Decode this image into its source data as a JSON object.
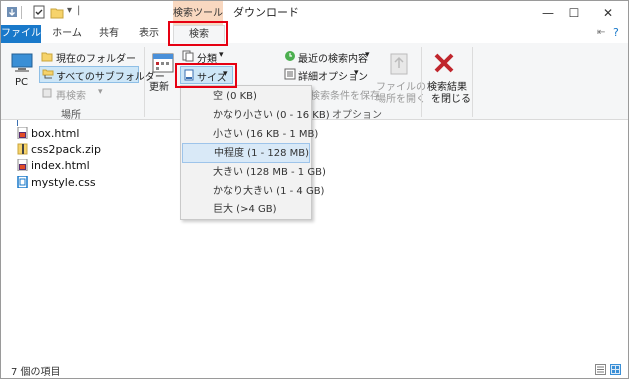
{
  "titlebar": {
    "context_tool": "検索ツール",
    "title": "ダウンロード",
    "minimize": "—",
    "maximize": "☐",
    "close": "✕"
  },
  "tabs": {
    "file": "ファイル",
    "home": "ホーム",
    "share": "共有",
    "view": "表示",
    "search": "検索"
  },
  "ribbon": {
    "location": {
      "pc": "PC",
      "current_folder": "現在のフォルダー",
      "all_subfolders": "すべてのサブフォルダー",
      "search_again": "再検索",
      "group_label": "場所"
    },
    "refine": {
      "refresh": "更新",
      "kind": "分類",
      "size": "サイズ"
    },
    "options": {
      "recent_searches": "最近の検索内容",
      "advanced_options": "詳細オプション",
      "save_search": "検索条件を保存",
      "open_location_line1": "ファイルの",
      "open_location_line2": "場所を開く",
      "close_search_line1": "検索結果",
      "close_search_line2": "を閉じる",
      "group_label": "オプション"
    }
  },
  "size_menu": {
    "items": [
      "空 (0 KB)",
      "かなり小さい (0 - 16 KB)",
      "小さい (16 KB - 1 MB)",
      "中程度 (1 - 128 MB)",
      "大きい (128 MB - 1 GB)",
      "かなり大きい (1 - 4 GB)",
      "巨大 (>4 GB)"
    ],
    "selected": "中程度 (1 - 128 MB)"
  },
  "files": [
    "box.html",
    "css2pack.zip",
    "index.html",
    "mystyle.css"
  ],
  "status": {
    "item_count": "7 個の項目"
  },
  "colors": {
    "file_tab": "#1979ca",
    "highlight": "#e60012",
    "context_tool": "#f9d8c0",
    "close_red": "#c0262d"
  }
}
